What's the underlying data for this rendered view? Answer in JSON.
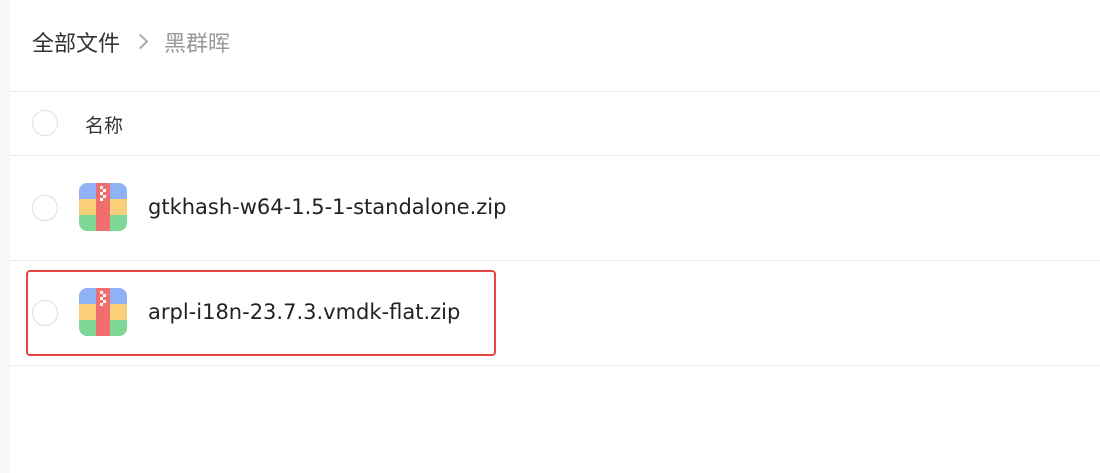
{
  "breadcrumb": {
    "root": "全部文件",
    "separator_icon": "chevron-right-icon",
    "current": "黑群晖"
  },
  "table": {
    "header": {
      "name_label": "名称"
    },
    "rows": [
      {
        "icon": "zip-archive-icon",
        "name": "gtkhash-w64-1.5-1-standalone.zip",
        "highlighted": false
      },
      {
        "icon": "zip-archive-icon",
        "name": "arpl-i18n-23.7.3.vmdk-flat.zip",
        "highlighted": true
      }
    ]
  },
  "colors": {
    "highlight_border": "#e34545",
    "divider": "#ececec",
    "zip_icon_blue": "#8fb2f7",
    "zip_icon_yellow": "#f9cf7a",
    "zip_icon_green": "#7ed795",
    "zip_icon_red": "#f06e6e"
  }
}
